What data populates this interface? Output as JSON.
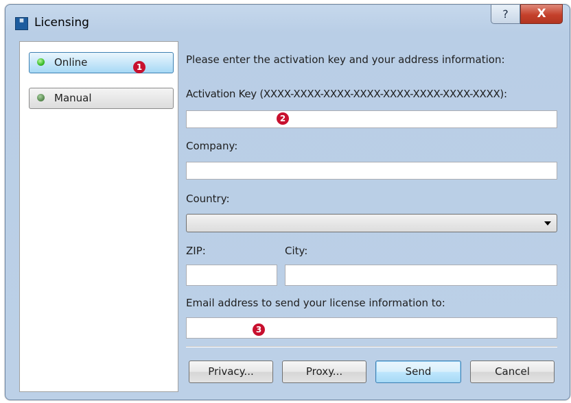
{
  "window": {
    "title": "Licensing",
    "help_glyph": "?",
    "close_glyph": "X"
  },
  "nav": {
    "online": "Online",
    "manual": "Manual"
  },
  "badges": {
    "one": "1",
    "two": "2",
    "three": "3"
  },
  "form": {
    "intro": "Please enter the activation key and your address information:",
    "activation_key_label": "Activation Key (XXXX-XXXX-XXXX-XXXX-XXXX-XXXX-XXXX-XXXX):",
    "activation_key_value": "",
    "company_label": "Company:",
    "company_value": "",
    "country_label": "Country:",
    "country_value": "",
    "zip_label": "ZIP:",
    "zip_value": "",
    "city_label": "City:",
    "city_value": "",
    "email_label": "Email address to send your license information to:",
    "email_value": ""
  },
  "buttons": {
    "privacy": "Privacy...",
    "proxy": "Proxy...",
    "send": "Send",
    "cancel": "Cancel"
  },
  "colors": {
    "accent_badge": "#c8102e",
    "led_on": "#3bbd2a",
    "close_button": "#c4402b"
  }
}
